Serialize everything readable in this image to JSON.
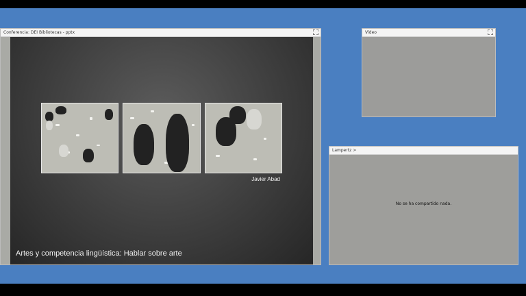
{
  "share_pod": {
    "title": "Conferencia: DEI Bibliotecas - pptx",
    "slide": {
      "credit": "Javier Abad",
      "caption": "Artes y competencia lingüística: Hablar sobre arte"
    }
  },
  "video_pod": {
    "title": "Vídeo"
  },
  "lamp_pod": {
    "title": "Lampertz >",
    "message": "No se ha compartido nada."
  },
  "icons": {
    "fullscreen": "fullscreen-icon"
  },
  "colors": {
    "desktop_bg": "#4a7fc1",
    "slide_bg": "#3e3e3e",
    "pod_body": "#9e9e9b"
  }
}
